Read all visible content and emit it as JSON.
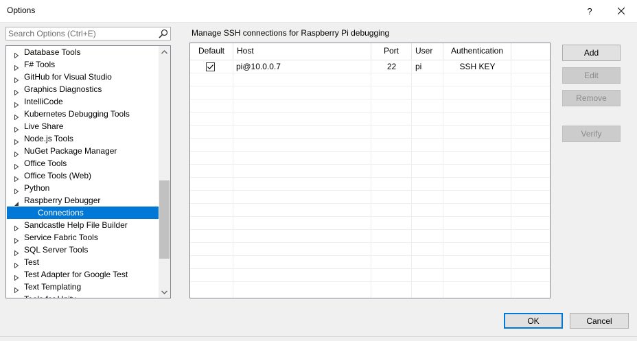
{
  "window": {
    "title": "Options",
    "help_glyph": "?",
    "close_label": "Close"
  },
  "search": {
    "placeholder": "Search Options (Ctrl+E)"
  },
  "tree": {
    "items": [
      {
        "label": "Database Tools",
        "state": "collapsed"
      },
      {
        "label": "F# Tools",
        "state": "collapsed"
      },
      {
        "label": "GitHub for Visual Studio",
        "state": "collapsed"
      },
      {
        "label": "Graphics Diagnostics",
        "state": "collapsed"
      },
      {
        "label": "IntelliCode",
        "state": "collapsed"
      },
      {
        "label": "Kubernetes Debugging Tools",
        "state": "collapsed"
      },
      {
        "label": "Live Share",
        "state": "collapsed"
      },
      {
        "label": "Node.js Tools",
        "state": "collapsed"
      },
      {
        "label": "NuGet Package Manager",
        "state": "collapsed"
      },
      {
        "label": "Office Tools",
        "state": "collapsed"
      },
      {
        "label": "Office Tools (Web)",
        "state": "collapsed"
      },
      {
        "label": "Python",
        "state": "collapsed"
      },
      {
        "label": "Raspberry Debugger",
        "state": "expanded"
      },
      {
        "label": "Connections",
        "state": "child",
        "selected": true
      },
      {
        "label": "Sandcastle Help File Builder",
        "state": "collapsed"
      },
      {
        "label": "Service Fabric Tools",
        "state": "collapsed"
      },
      {
        "label": "SQL Server Tools",
        "state": "collapsed"
      },
      {
        "label": "Test",
        "state": "collapsed"
      },
      {
        "label": "Test Adapter for Google Test",
        "state": "collapsed"
      },
      {
        "label": "Text Templating",
        "state": "collapsed"
      },
      {
        "label": "Tools for Unity",
        "state": "collapsed",
        "partial": true
      }
    ]
  },
  "panel": {
    "title": "Manage SSH connections for Raspberry Pi debugging",
    "columns": {
      "default": "Default",
      "host": "Host",
      "port": "Port",
      "user": "User",
      "auth": "Authentication"
    },
    "rows": [
      {
        "default_checked": true,
        "host": "pi@10.0.0.7",
        "port": "22",
        "user": "pi",
        "auth": "SSH KEY"
      }
    ]
  },
  "buttons": {
    "add": "Add",
    "edit": "Edit",
    "remove": "Remove",
    "verify": "Verify"
  },
  "footer": {
    "ok": "OK",
    "cancel": "Cancel"
  },
  "colors": {
    "selection": "#0078d7",
    "window_bg": "#f0f0f0"
  }
}
